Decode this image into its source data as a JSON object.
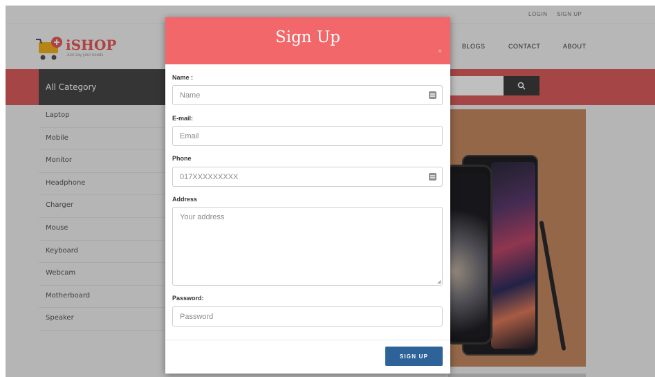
{
  "site": {
    "top_links": {
      "login": "LOGIN",
      "signup": "SIGN UP"
    },
    "logo": {
      "name": "iSHOP",
      "tagline": "Just say your needs"
    },
    "nav": {
      "blogs": "BLOGS",
      "contact": "CONTACT",
      "about": "ABOUT"
    },
    "category_header": "All Category",
    "categories": [
      "Laptop",
      "Mobile",
      "Monitor",
      "Headphone",
      "Charger",
      "Mouse",
      "Keyboard",
      "Webcam",
      "Motherboard",
      "Speaker"
    ],
    "search_icon": "search-icon",
    "colors": {
      "accent_red": "#dd5d5d",
      "dark": "#474747"
    }
  },
  "modal": {
    "title": "Sign Up",
    "close_icon": "close-icon",
    "colors": {
      "header": "#f2686a",
      "button": "#2d6399"
    },
    "name": {
      "label": "Name :",
      "placeholder": "Name"
    },
    "email": {
      "label": "E-mail:",
      "placeholder": "Email"
    },
    "phone": {
      "label": "Phone",
      "placeholder": "017XXXXXXXXX"
    },
    "address": {
      "label": "Address",
      "placeholder": "Your address"
    },
    "password": {
      "label": "Password:",
      "placeholder": "Password"
    },
    "submit_label": "SIGN UP"
  }
}
